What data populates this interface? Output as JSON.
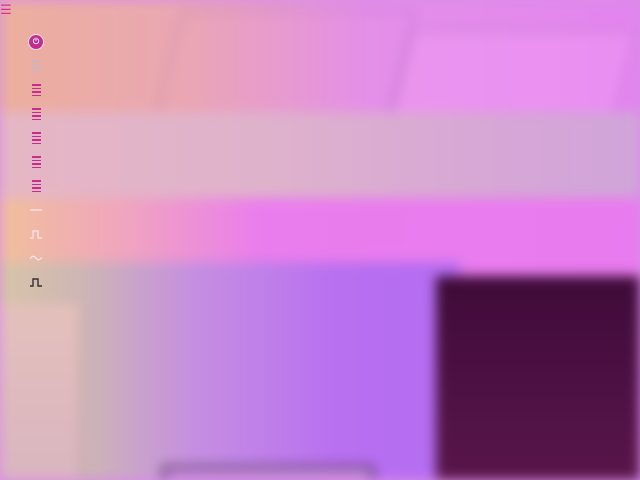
{
  "window": {
    "background": "#d98de8"
  },
  "icons": {
    "menu": "menu-icon",
    "tools": [
      {
        "id": "power",
        "icon": "power-icon",
        "active": true
      },
      {
        "id": "filter-1",
        "icon": "list-icon"
      },
      {
        "id": "filter-2",
        "icon": "list-icon"
      },
      {
        "id": "filter-3",
        "icon": "list-icon"
      },
      {
        "id": "filter-4",
        "icon": "list-icon"
      },
      {
        "id": "filter-5",
        "icon": "list-icon"
      },
      {
        "id": "filter-6",
        "icon": "list-icon"
      },
      {
        "id": "flat",
        "icon": "flat-line-icon"
      },
      {
        "id": "pulse",
        "icon": "pulse-icon"
      },
      {
        "id": "wave",
        "icon": "sine-wave-icon"
      },
      {
        "id": "square",
        "icon": "square-wave-icon"
      }
    ]
  },
  "colors": {
    "accent": "#c62d8f",
    "inactive": "#c8b7c1",
    "dark": "#3a2e34"
  }
}
